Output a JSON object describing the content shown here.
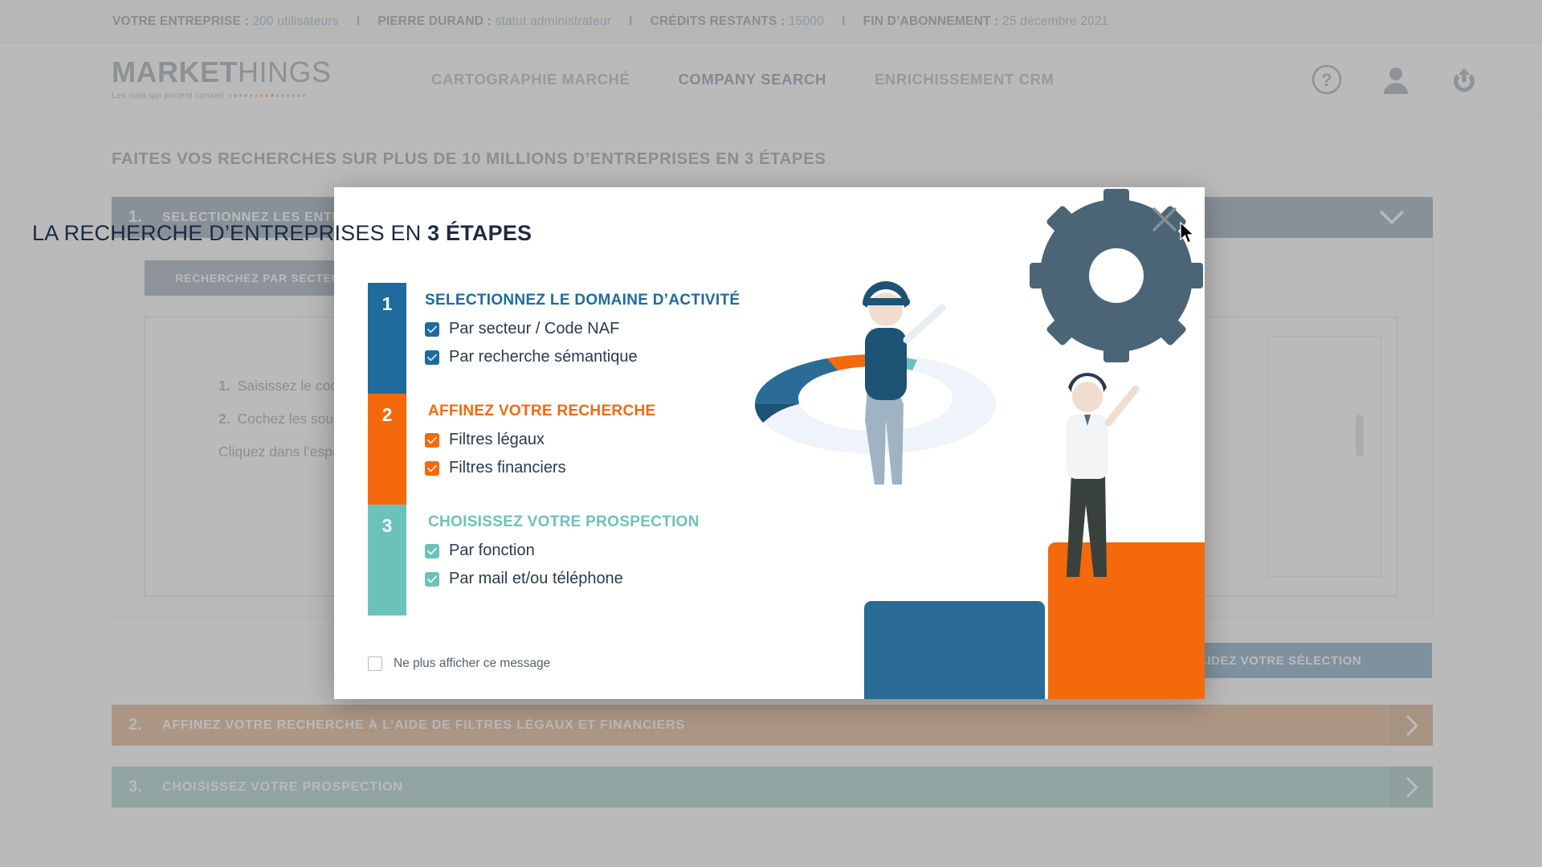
{
  "topbar": {
    "company_label": "VOTRE ENTREPRISE :",
    "company_value": "200 utilisateurs",
    "user_label": "PIERRE DURAND :",
    "user_value": "statut administrateur",
    "credits_label": "CRÉDITS RESTANTS :",
    "credits_value": "15000",
    "subscription_label": "FIN D’ABONNEMENT :",
    "subscription_value": "25 décembre 2021",
    "separator": "I"
  },
  "logo": {
    "bold": "MARKET",
    "light": "HINGS",
    "tagline": "Les data qui portent conseil"
  },
  "nav": {
    "items": [
      {
        "label": "CARTOGRAPHIE MARCHÉ",
        "active": false
      },
      {
        "label": "COMPANY SEARCH",
        "active": true
      },
      {
        "label": "ENRICHISSEMENT CRM",
        "active": false
      }
    ]
  },
  "header_icons": [
    {
      "name": "help-icon",
      "label": "?"
    },
    {
      "name": "user-icon",
      "label": ""
    },
    {
      "name": "logout-icon",
      "label": ""
    }
  ],
  "page": {
    "title": "FAITES VOS RECHERCHES SUR PLUS DE 10 MILLIONS D’ENTREPRISES EN 3 ÉTAPES",
    "accordion1": {
      "num": "1.",
      "label": "SELECTIONNEZ LES ENTREPRISES PAR DOMAINE D’ACTIVITÉ"
    },
    "accordion2": {
      "num": "2.",
      "label": "AFFINEZ VOTRE RECHERCHE À L’AIDE DE FILTRES LÉGAUX ET FINANCIERS"
    },
    "accordion3": {
      "num": "3.",
      "label": "CHOISISSEZ VOTRE PROSPECTION"
    },
    "sector_button": "RECHERCHEZ PAR SECTEUR / CODE NAF",
    "instructions": [
      {
        "num": "1.",
        "text": "Saisissez le code NAF ou le secteur d’activité"
      },
      {
        "num": "2.",
        "text": "Cochez les sous-secteurs souhaités"
      }
    ],
    "instruction_footer": "Cliquez dans l’espace ci-dessus pour commencer",
    "selection_button": "VALIDEZ VOTRE SÉLECTION"
  },
  "modal": {
    "title_plain": "LA RECHERCHE D’ENTREPRISES EN ",
    "title_bold": "3 ÉTAPES",
    "close_label": "×",
    "optout_label": "Ne plus afficher ce message",
    "steps": [
      {
        "number": "1",
        "heading": "SELECTIONNEZ LE DOMAINE D’ACTIVITÉ",
        "color": "#1f6b9e",
        "items": [
          "Par secteur / Code NAF",
          "Par recherche sémantique"
        ]
      },
      {
        "number": "2",
        "heading": "AFFINEZ VOTRE RECHERCHE",
        "color": "#f4690c",
        "items": [
          "Filtres légaux",
          "Filtres financiers"
        ]
      },
      {
        "number": "3",
        "heading": "CHOISISSEZ VOTRE PROSPECTION",
        "color": "#6cc2bb",
        "items": [
          "Par fonction",
          "Par mail et/ou téléphone"
        ]
      }
    ]
  },
  "colors": {
    "blue": "#1f6b9e",
    "orange": "#f4690c",
    "teal": "#6cc2bb",
    "slate": "#4c6e85",
    "dark_text": "#1b2a44"
  }
}
